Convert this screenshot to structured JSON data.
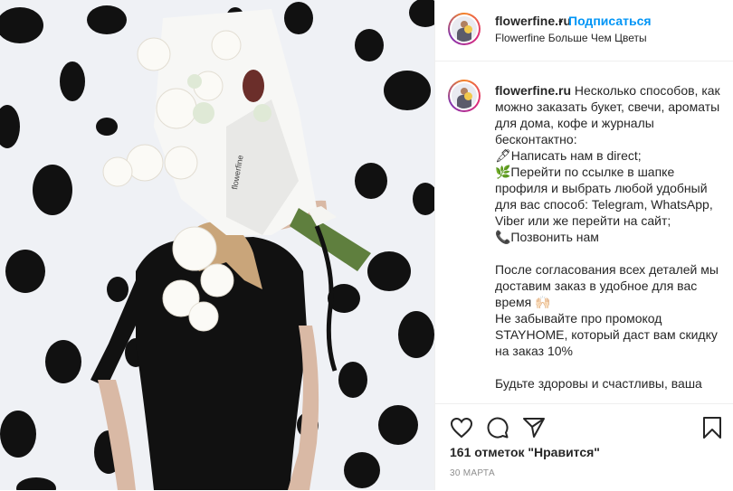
{
  "post": {
    "username": "flowerfine.ru",
    "follow_label": "Подписаться",
    "subtitle": "Flowerfine Больше Чем Цветы",
    "caption_lines": [
      "Несколько способов, как можно заказать букет, свечи, ароматы для дома, кофе и журналы бесконтактно:",
      "🖋Написать нам в direct;",
      "🌿Перейти по ссылке в шапке профиля и выбрать любой удобный для вас способ: Telegram, WhatsApp, Viber или же перейти на сайт;",
      "📞Позвонить нам",
      "",
      "После согласования всех деталей мы доставим заказ в удобное для вас время 🙌🏻",
      "Не забывайте про промокод STAYHOME, который даст вам скидку на заказ 10%",
      "",
      "Будьте здоровы и счастливы, ваша"
    ],
    "likes_text": "161 отметок \"Нравится\"",
    "date": "30 МАРТА",
    "photo_brand_text": "flowerfine"
  },
  "icons": {
    "like": "heart-icon",
    "comment": "comment-icon",
    "share": "paper-plane-icon",
    "save": "bookmark-icon"
  },
  "colors": {
    "accent": "#0095f6",
    "text": "#262626",
    "muted": "#8e8e8e",
    "border": "#efefef"
  }
}
